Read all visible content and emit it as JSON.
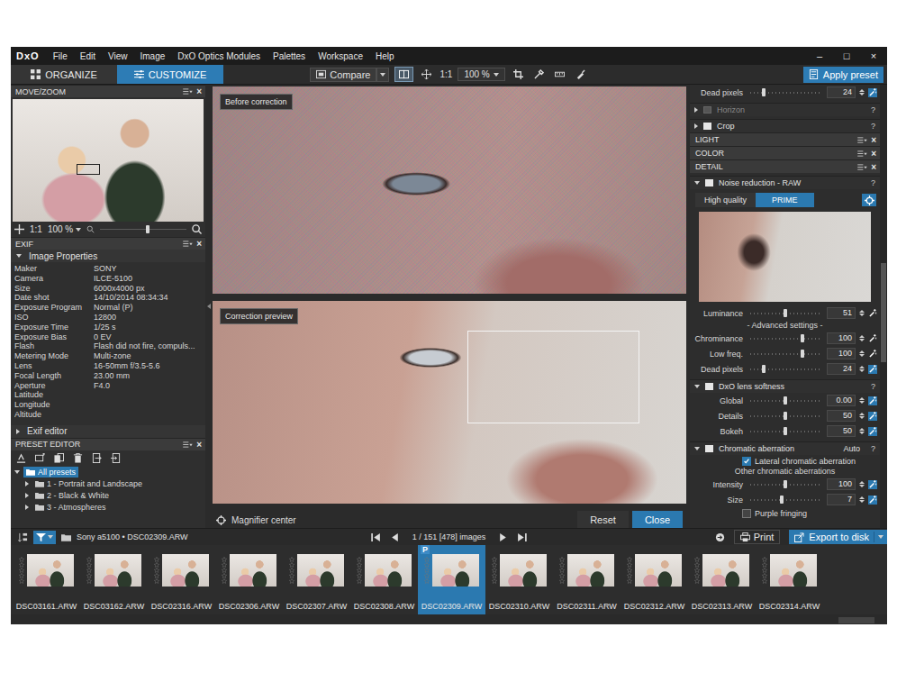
{
  "menubar": {
    "logo": "DxO",
    "items": [
      "File",
      "Edit",
      "View",
      "Image",
      "DxO Optics Modules",
      "Palettes",
      "Workspace",
      "Help"
    ],
    "window_controls": [
      "–",
      "□",
      "×"
    ]
  },
  "toolbar": {
    "modes": [
      {
        "label": "ORGANIZE",
        "selected": false
      },
      {
        "label": "CUSTOMIZE",
        "selected": true
      }
    ],
    "compare": "Compare",
    "ratio": "1:1",
    "zoom": "100 %",
    "apply_preset": "Apply preset"
  },
  "move_zoom": {
    "title": "MOVE/ZOOM",
    "close": "×",
    "ratio": "1:1",
    "zoom": "100 %",
    "level": 0.55
  },
  "exif": {
    "title": "EXIF",
    "close": "×",
    "section": {
      "label": "Image Properties",
      "expanded": true
    },
    "rows": [
      {
        "key": "Maker",
        "value": "SONY"
      },
      {
        "key": "Camera",
        "value": "ILCE-5100"
      },
      {
        "key": "Size",
        "value": "6000x4000 px"
      },
      {
        "key": "Date shot",
        "value": "14/10/2014 08:34:34"
      },
      {
        "key": "Exposure Program",
        "value": "Normal (P)"
      },
      {
        "key": "ISO",
        "value": "12800"
      },
      {
        "key": "Exposure Time",
        "value": "1/25 s"
      },
      {
        "key": "Exposure Bias",
        "value": "0 EV"
      },
      {
        "key": "Flash",
        "value": "Flash did not fire, compuls..."
      },
      {
        "key": "Metering Mode",
        "value": "Multi-zone"
      },
      {
        "key": "Lens",
        "value": "16-50mm f/3.5-5.6"
      },
      {
        "key": "Focal Length",
        "value": "23.00 mm"
      },
      {
        "key": "Aperture",
        "value": "F4.0"
      },
      {
        "key": "Latitude",
        "value": ""
      },
      {
        "key": "Longitude",
        "value": ""
      },
      {
        "key": "Altitude",
        "value": ""
      }
    ],
    "editor": {
      "label": "Exif editor",
      "expanded": false
    }
  },
  "preset_editor": {
    "title": "PRESET EDITOR",
    "close": "×",
    "tree": [
      {
        "label": "All presets",
        "depth": 0,
        "expanded": true,
        "selected": true
      },
      {
        "label": "1 - Portrait and Landscape",
        "depth": 1,
        "expanded": false,
        "selected": false
      },
      {
        "label": "2 - Black & White",
        "depth": 1,
        "expanded": false,
        "selected": false
      },
      {
        "label": "3 - Atmospheres",
        "depth": 1,
        "expanded": false,
        "selected": false
      }
    ]
  },
  "viewer": {
    "panes": [
      {
        "label": "Before correction",
        "kind": "noisy"
      },
      {
        "label": "Correction preview",
        "kind": "clean"
      }
    ],
    "magnifier": "Magnifier center",
    "buttons": [
      {
        "label": "Reset",
        "primary": false
      },
      {
        "label": "Close",
        "primary": true
      }
    ]
  },
  "settings": {
    "rows": [
      {
        "kind": "slider",
        "label": "Dead pixels",
        "value": "24",
        "level": 0.2,
        "auto": true
      },
      {
        "kind": "section",
        "label": "Horizon",
        "expanded": false,
        "on": false,
        "disabled": true,
        "extra": "",
        "help": "?"
      },
      {
        "kind": "section",
        "label": "Crop",
        "expanded": false,
        "on": true,
        "disabled": false,
        "extra": "",
        "help": "?"
      },
      {
        "kind": "palette",
        "label": "LIGHT",
        "close": "×"
      },
      {
        "kind": "palette",
        "label": "COLOR",
        "close": "×"
      },
      {
        "kind": "palette",
        "label": "DETAIL",
        "close": "×"
      },
      {
        "kind": "section",
        "label": "Noise reduction - RAW",
        "expanded": true,
        "on": true,
        "disabled": false,
        "extra": "",
        "help": "?"
      },
      {
        "kind": "tabs",
        "tabs": [
          {
            "label": "High quality",
            "selected": false
          },
          {
            "label": "PRIME",
            "selected": true
          }
        ]
      },
      {
        "kind": "preview"
      },
      {
        "kind": "slider",
        "label": "Luminance",
        "value": "51",
        "level": 0.5,
        "auto": false
      },
      {
        "kind": "note",
        "label": "- Advanced settings -"
      },
      {
        "kind": "slider",
        "label": "Chrominance",
        "value": "100",
        "level": 0.75,
        "auto": false
      },
      {
        "kind": "slider",
        "label": "Low freq.",
        "value": "100",
        "level": 0.75,
        "auto": false
      },
      {
        "kind": "slider",
        "label": "Dead pixels",
        "value": "24",
        "level": 0.2,
        "auto": true
      },
      {
        "kind": "section",
        "label": "DxO lens softness",
        "expanded": true,
        "on": true,
        "disabled": false,
        "extra": "",
        "help": "?"
      },
      {
        "kind": "slider",
        "label": "Global",
        "value": "0.00",
        "level": 0.5,
        "auto": true
      },
      {
        "kind": "slider",
        "label": "Details",
        "value": "50",
        "level": 0.5,
        "auto": true
      },
      {
        "kind": "slider",
        "label": "Bokeh",
        "value": "50",
        "level": 0.5,
        "auto": true
      },
      {
        "kind": "section",
        "label": "Chromatic aberration",
        "expanded": true,
        "on": true,
        "disabled": false,
        "extra": "Auto",
        "help": "?"
      },
      {
        "kind": "check",
        "label": "Lateral chromatic aberration",
        "checked": true
      },
      {
        "kind": "note",
        "label": "Other chromatic aberrations"
      },
      {
        "kind": "slider",
        "label": "Intensity",
        "value": "100",
        "level": 0.5,
        "auto": true
      },
      {
        "kind": "slider",
        "label": "Size",
        "value": "7",
        "level": 0.45,
        "auto": true
      },
      {
        "kind": "check",
        "label": "Purple fringing",
        "checked": false
      }
    ]
  },
  "browser_bar": {
    "folder": "Sony a5100 • DSC02309.ARW",
    "position": "1 / 151 [478] images",
    "print": "Print",
    "export": "Export to disk"
  },
  "filmstrip": [
    {
      "name": "DSC03161.ARW",
      "selected": false,
      "badge": "",
      "stars": 0
    },
    {
      "name": "DSC03162.ARW",
      "selected": false,
      "badge": "",
      "stars": 0
    },
    {
      "name": "DSC02316.ARW",
      "selected": false,
      "badge": "",
      "stars": 0
    },
    {
      "name": "DSC02306.ARW",
      "selected": false,
      "badge": "",
      "stars": 0
    },
    {
      "name": "DSC02307.ARW",
      "selected": false,
      "badge": "",
      "stars": 0
    },
    {
      "name": "DSC02308.ARW",
      "selected": false,
      "badge": "",
      "stars": 0
    },
    {
      "name": "DSC02309.ARW",
      "selected": true,
      "badge": "P",
      "stars": 0
    },
    {
      "name": "DSC02310.ARW",
      "selected": false,
      "badge": "",
      "stars": 0
    },
    {
      "name": "DSC02311.ARW",
      "selected": false,
      "badge": "",
      "stars": 0
    },
    {
      "name": "DSC02312.ARW",
      "selected": false,
      "badge": "",
      "stars": 0
    },
    {
      "name": "DSC02313.ARW",
      "selected": false,
      "badge": "",
      "stars": 0
    },
    {
      "name": "DSC02314.ARW",
      "selected": false,
      "badge": "",
      "stars": 0
    }
  ]
}
